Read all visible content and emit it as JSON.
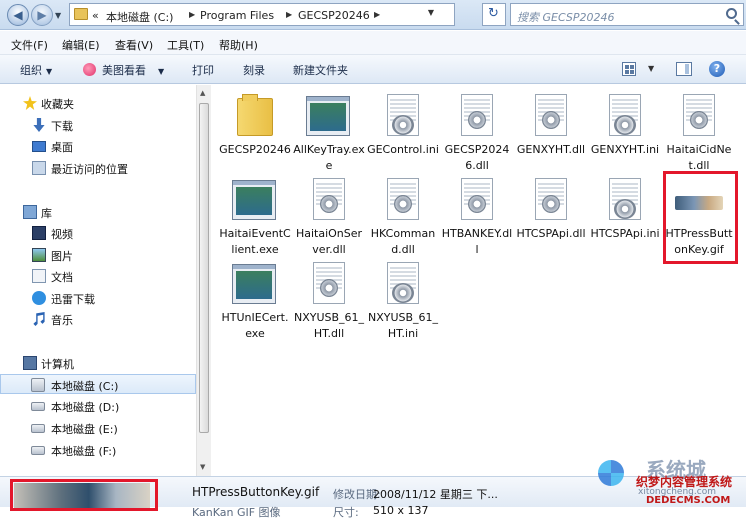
{
  "address": {
    "breadcrumbs": [
      "本地磁盘 (C:)",
      "Program Files",
      "GECSP20246"
    ],
    "overflow": "«"
  },
  "search": {
    "placeholder": "搜索 GECSP20246"
  },
  "menu": [
    "文件(F)",
    "编辑(E)",
    "查看(V)",
    "工具(T)",
    "帮助(H)"
  ],
  "commands": {
    "organize": "组织",
    "meitu": "美图看看",
    "print": "打印",
    "burn": "刻录",
    "new_folder": "新建文件夹"
  },
  "nav": {
    "favorites": "收藏夹",
    "downloads": "下载",
    "desktop": "桌面",
    "recent": "最近访问的位置",
    "libraries": "库",
    "videos": "视频",
    "pictures": "图片",
    "documents": "文档",
    "xunlei": "迅雷下载",
    "music": "音乐",
    "computer": "计算机",
    "drive_c": "本地磁盘 (C:)",
    "drive_d": "本地磁盘 (D:)",
    "drive_e": "本地磁盘 (E:)",
    "drive_f": "本地磁盘 (F:)"
  },
  "files": [
    {
      "name": "GECSP20246",
      "type": "folder"
    },
    {
      "name": "AllKeyTray.exe",
      "type": "exe"
    },
    {
      "name": "GEControl.ini",
      "type": "ini"
    },
    {
      "name": "GECSP20246.dll",
      "type": "dll"
    },
    {
      "name": "GENXYHT.dll",
      "type": "dll"
    },
    {
      "name": "GENXYHT.ini",
      "type": "ini"
    },
    {
      "name": "HaitaiCidNet.dll",
      "type": "dll"
    },
    {
      "name": "HaitaiEventClient.exe",
      "type": "exe"
    },
    {
      "name": "HaitaiOnServer.dll",
      "type": "dll"
    },
    {
      "name": "HKCommand.dll",
      "type": "dll"
    },
    {
      "name": "HTBANKEY.dll",
      "type": "dll"
    },
    {
      "name": "HTCSPApi.dll",
      "type": "dll"
    },
    {
      "name": "HTCSPApi.ini",
      "type": "ini"
    },
    {
      "name": "HTPressButtonKey.gif",
      "type": "gif",
      "highlighted": true
    },
    {
      "name": "HTUnIECert.exe",
      "type": "exe"
    },
    {
      "name": "NXYUSB_61_HT.dll",
      "type": "dll"
    },
    {
      "name": "NXYUSB_61_HT.ini",
      "type": "ini"
    }
  ],
  "details": {
    "filename": "HTPressButtonKey.gif",
    "modified_label": "修改日期:",
    "modified_value": "2008/11/12 星期三 下...",
    "type_value": "KanKan GIF 图像",
    "dims_label": "尺寸:",
    "dims_value": "510 x 137"
  },
  "watermark": {
    "brand": "系统城",
    "line1": "织梦内容管理系统",
    "line2": "xitongcheng.com",
    "line3": "DEDECMS.COM"
  }
}
